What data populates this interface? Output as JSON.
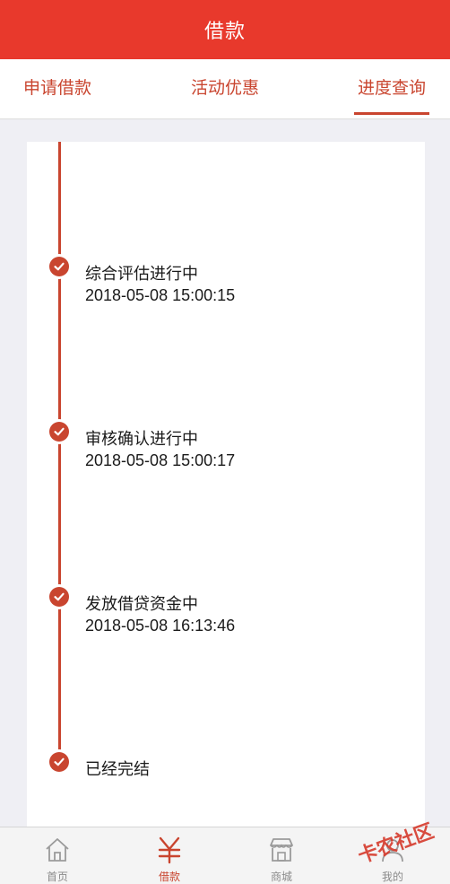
{
  "header": {
    "title": "借款"
  },
  "tabs": [
    {
      "label": "申请借款"
    },
    {
      "label": "活动优惠"
    },
    {
      "label": "进度查询"
    }
  ],
  "timeline": {
    "steps": [
      {
        "title": "综合评估进行中",
        "time": "2018-05-08 15:00:15"
      },
      {
        "title": "审核确认进行中",
        "time": "2018-05-08 15:00:17"
      },
      {
        "title": "发放借贷资金中",
        "time": "2018-05-08 16:13:46"
      },
      {
        "title": "已经完结",
        "time": ""
      }
    ]
  },
  "nav": {
    "items": [
      {
        "label": "首页",
        "icon": "home-icon"
      },
      {
        "label": "借款",
        "icon": "yen-icon"
      },
      {
        "label": "商城",
        "icon": "store-icon"
      },
      {
        "label": "我的",
        "icon": "user-icon"
      }
    ]
  },
  "watermark": {
    "text": "卡农社区"
  },
  "colors": {
    "brand": "#e8392c",
    "accent": "#c9452f",
    "background": "#efeff4"
  }
}
